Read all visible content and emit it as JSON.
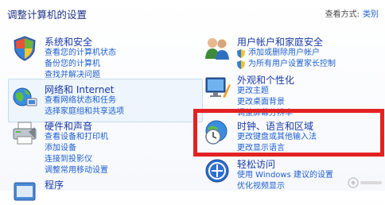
{
  "header": {
    "title": "调整计算机的设置",
    "view_by_label": "查看方式:",
    "view_by_value": "类别"
  },
  "categories": [
    {
      "title": "系统和安全",
      "icon": "shield-flag-icon",
      "links": [
        "查看您的计算机状态",
        "备份您的计算机",
        "查找并解决问题"
      ]
    },
    {
      "title": "网络和 Internet",
      "icon": "network-globe-icon",
      "links": [
        "查看网络状态和任务",
        "选择家庭组和共享选项"
      ]
    },
    {
      "title": "硬件和声音",
      "icon": "printer-icon",
      "links": [
        "查看设备和打印机",
        "添加设备",
        "连接到投影仪",
        "调整常用移动设置"
      ]
    },
    {
      "title": "程序",
      "icon": "programs-icon",
      "links": []
    },
    {
      "title": "用户帐户和家庭安全",
      "icon": "users-icon",
      "links": [
        "添加或删除用户帐户",
        "为所有用户设置家长控制"
      ]
    },
    {
      "title": "外观和个性化",
      "icon": "monitor-brush-icon",
      "links": [
        "更改主题",
        "更改桌面背景",
        "调整屏幕分辨率"
      ]
    },
    {
      "title": "时钟、语言和区域",
      "icon": "clock-globe-icon",
      "links": [
        "更改键盘或其他输入法",
        "更改显示语言"
      ]
    },
    {
      "title": "轻松访问",
      "icon": "ease-of-access-icon",
      "links": [
        "使用 Windows 建议的设置",
        "优化视频显示"
      ]
    }
  ],
  "colors": {
    "link": "#1e5fcf",
    "title": "#1a3aa8",
    "highlight": "#e32222"
  },
  "watermark": {
    "icon": "watermark-logo-icon"
  }
}
